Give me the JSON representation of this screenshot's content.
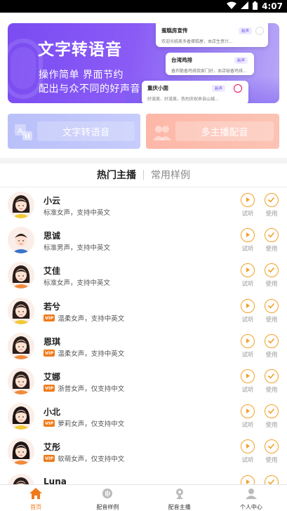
{
  "status_bar": {
    "time": "4:07"
  },
  "banner": {
    "title": "文字转语音",
    "subtitle_line1": "操作简单 界面节约",
    "subtitle_line2": "配出与众不同的好声音",
    "cards": [
      {
        "title": "蛋糕房宣传",
        "tag": "新声",
        "text": "欢迎光临美多香蛋糕屋，本店生意兴..."
      },
      {
        "title": "台湾鸡排",
        "tag": "新声",
        "text": "香炸脆香鸡排我家门好，本店秘香鸡排..."
      },
      {
        "title": "重庆小面",
        "tag": "新声",
        "text": "好滋美、好滋美，热烈庆祝来自山城..."
      }
    ]
  },
  "features": [
    {
      "label": "文字转语音",
      "icon": "text-to-speech-icon"
    },
    {
      "label": "多主播配音",
      "icon": "multi-anchor-icon"
    }
  ],
  "tabs": [
    {
      "label": "热门主播",
      "active": true
    },
    {
      "label": "常用样例",
      "active": false
    }
  ],
  "actions": {
    "listen_label": "试听",
    "use_label": "使用"
  },
  "vip_label": "VIP",
  "anchors": [
    {
      "name": "小云",
      "desc": "标准女声，支持中英文",
      "vip": false,
      "gender": "female"
    },
    {
      "name": "思诚",
      "desc": "标准男声，支持中英文",
      "vip": false,
      "gender": "male"
    },
    {
      "name": "艾佳",
      "desc": "标准女声，支持中英文",
      "vip": false,
      "gender": "female"
    },
    {
      "name": "若兮",
      "desc": "温柔女声，支持中英文",
      "vip": true,
      "gender": "female"
    },
    {
      "name": "恩琪",
      "desc": "温柔女声，支持中英文",
      "vip": true,
      "gender": "female"
    },
    {
      "name": "艾娜",
      "desc": "浙普女声，仅支持中文",
      "vip": true,
      "gender": "female"
    },
    {
      "name": "小北",
      "desc": "萝莉女声，仅支持中文",
      "vip": true,
      "gender": "girl"
    },
    {
      "name": "艾彤",
      "desc": "软萌女声，仅支持中文",
      "vip": true,
      "gender": "girl"
    },
    {
      "name": "Luna",
      "desc": "",
      "vip": false,
      "gender": "female"
    }
  ],
  "bottom_nav": [
    {
      "label": "首页",
      "icon": "home-icon",
      "active": true
    },
    {
      "label": "配音样例",
      "icon": "sample-icon",
      "active": false
    },
    {
      "label": "配音主播",
      "icon": "anchor-icon",
      "active": false
    },
    {
      "label": "个人中心",
      "icon": "profile-icon",
      "active": false
    }
  ],
  "colors": {
    "accent": "#f2a025",
    "banner_purple": "#7a4cf2",
    "active_nav": "#f07a1a"
  }
}
